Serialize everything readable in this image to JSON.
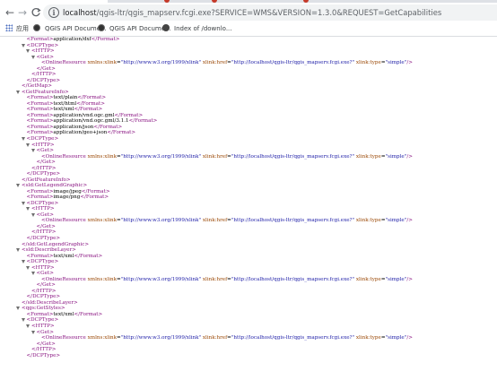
{
  "browser": {
    "nav": {
      "back": "←",
      "forward": "→",
      "reload": "C"
    },
    "url_host": "localhost",
    "url_rest": "/qgis-ltr/qgis_mapserv.fcgi.exe?SERVICE=WMS&VERSION=1.3.0&REQUEST=GetCapabilities",
    "info_glyph": "i",
    "bookmarks": [
      {
        "label": "应用",
        "icon": "apps-grid-icon"
      },
      {
        "label": "QGIS API Docume...",
        "icon": "qgis-favicon-icon"
      },
      {
        "label": "QGIS API Docume...",
        "icon": "qgis-favicon-icon"
      },
      {
        "label": "Index of /downlo...",
        "icon": "web-favicon-icon"
      }
    ],
    "colors": {
      "tag": "#881280",
      "attr_name": "#994500",
      "attr_value": "#1a1aa6"
    }
  },
  "xml": {
    "open_format": "<Format>",
    "close_format": "</Format>",
    "dcptype_open": "<DCPType>",
    "dcptype_close": "</DCPType>",
    "http_open": "<HTTP>",
    "http_close": "</HTTP>",
    "get_open": "<Get>",
    "get_close": "</Get>",
    "online_tag": "<OnlineResource",
    "online_attr_xmlns": "xmlns:xlink",
    "online_val_xmlns": "\"http://www.w3.org/1999/xlink\"",
    "online_attr_href": "xlink:href",
    "online_val_href": "\"http://localhost/qgis-ltr/qgis_mapserv.fcgi.exe?\"",
    "online_attr_type": "xlink:type",
    "online_val_type": "\"simple\"",
    "online_end": "/>",
    "equals": "=",
    "getmap_close": "</GetMap>",
    "gfi_open": "<GetFeatureInfo>",
    "gfi_close": "</GetFeatureInfo>",
    "glg_open": "<sld:GetLegendGraphic>",
    "glg_close": "</sld:GetLegendGraphic>",
    "dl_open": "<sld:DescribeLayer>",
    "dl_close": "</sld:DescribeLayer>",
    "gs_open": "<qgs:GetStyles>",
    "formats": {
      "dxf": "application/dxf",
      "plain": "text/plain",
      "html": "text/html",
      "xml": "text/xml",
      "gml": "application/vnd.ogc.gml",
      "gml311": "application/vnd.ogc.gml/3.1.1",
      "json": "application/json",
      "geojson": "application/geo+json",
      "jpeg": "image/jpeg",
      "png": "image/png"
    }
  }
}
